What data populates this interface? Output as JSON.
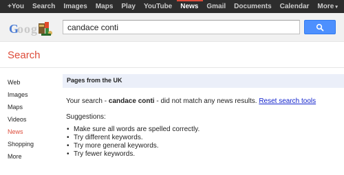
{
  "topnav": {
    "items": [
      "+You",
      "Search",
      "Images",
      "Maps",
      "Play",
      "YouTube",
      "News",
      "Gmail",
      "Documents",
      "Calendar",
      "More"
    ],
    "active_index": 6,
    "more_caret": "▾"
  },
  "search": {
    "query": "candace conti",
    "button_icon": "search-icon"
  },
  "section": {
    "title": "Search"
  },
  "leftnav": {
    "items": [
      "Web",
      "Images",
      "Maps",
      "Videos",
      "News",
      "Shopping",
      "More"
    ],
    "active_index": 4
  },
  "results": {
    "region_label": "Pages from the UK",
    "noresult_prefix": "Your search - ",
    "noresult_query": "candace conti",
    "noresult_suffix": " - did not match any news results. ",
    "reset_link": "Reset search tools",
    "suggestions_label": "Suggestions:",
    "suggestions": [
      "Make sure all words are spelled correctly.",
      "Try different keywords.",
      "Try more general keywords.",
      "Try fewer keywords."
    ]
  },
  "colors": {
    "accent_red": "#dd4b39",
    "search_blue": "#4d90fe",
    "link_blue": "#1122cc",
    "topbar_bg": "#2d2d2d"
  }
}
